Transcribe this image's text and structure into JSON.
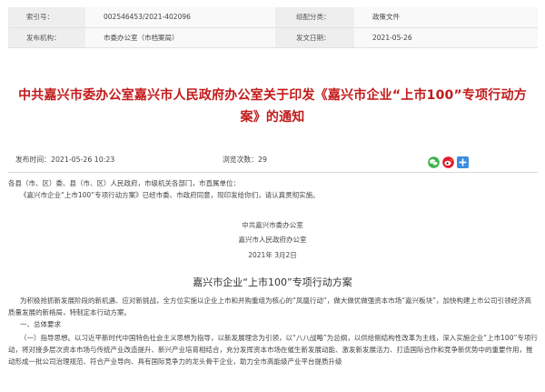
{
  "meta": {
    "rows": [
      {
        "k1": "索引号：",
        "v1": "002546453/2021-402096",
        "k2": "组配分类：",
        "v2": "政策文件"
      },
      {
        "k1": "发布机构：",
        "v1": "市委办公室（市档案局）",
        "k2": "发文日期：",
        "v2": "2021-05-26"
      }
    ]
  },
  "title": "中共嘉兴市委办公室嘉兴市人民政府办公室关于印发《嘉兴市企业“上市100”专项行动方案》的通知",
  "info": {
    "publish_time": "发布时间：2021-05-26 10:23",
    "views_label": "浏览次数：",
    "views_count": "29"
  },
  "share_icons": [
    "wechat-icon",
    "weibo-icon",
    "share-plus-icon"
  ],
  "body": {
    "recipients": "各县（市、区）委、县（市、区）人民政府，市级机关各部门，市直属单位：",
    "notice": "《嘉兴市企业“上市100”专项行动方案》已经市委、市政府同意，现印发给你们，请认真贯彻实施。",
    "sign1": "中共嘉兴市委办公室",
    "sign2": "嘉兴市人民政府办公室",
    "date": "2021年 3月2日"
  },
  "doc": {
    "title": "嘉兴市企业“上市100”专项行动方案",
    "intro": "为积极抢抓新发展阶段的新机遇、应对新挑战，全方位实施以企业上市和并购重组为核心的“凤凰行动”，做大做优做强资本市场“嘉兴板块”，加快构建上市公司引领经济高质量发展的新格局，特制定本行动方案。",
    "section1": "一、总体要求",
    "para1": "（一）指导思想。以习近平新时代中国特色社会主义思想为指导，以新发展理念为引领，以“八八战略”为总纲，以供给侧结构性改革为主线，深入实施企业“上市100”专项行动，将对接多层次资本市场与传统产业改造提升、新兴产业培育相结合，充分发挥资本市场在催生新发展动能、激发新发展活力、打造国际合作和竞争新优势中的重要作用，推动形成一批公司治理规范、符合产业导向、具有国际竞争力的龙头骨干企业，助力全市高能级产业平台提质升级"
  }
}
